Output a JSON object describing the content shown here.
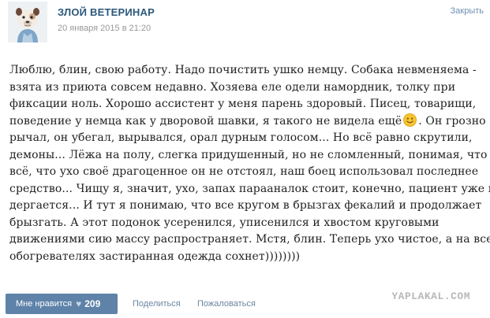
{
  "post": {
    "author": "ЗЛОЙ ВЕТЕРИНАР",
    "date": "20 января 2015 в 21:20",
    "close_label": "Закрыть",
    "lines": [
      "Люблю, блин, свою работу. Надо почистить ушко немцу. Собака невменяема -",
      "взята из приюта совсем недавно. Хозяева еле одели намордник, толку при",
      "фиксации ноль. Хорошо ассистент у меня парень здоровый. Писец, товарищи,",
      "поведение у немца как у дворовой шавки, я такого не видела ещё",
      ". Он грозно",
      "рычал, он убегал, вырывался, орал дурным голосом... Но всё равно скрутили,",
      "демоны... Лёжа на полу, слегка придушенный, но не сломленный, понимая, что",
      "всё, что ухо своё драгоценное он не отстоял, наш боец использовал последнее",
      "средство... Чищу я, значит, ухо, запах парааналок стоит, конечно, пациент уже не",
      "дергается... И тут я понимаю, что все кругом в брызгах фекалий и продолжает",
      "брызгать. А этот подонок усеренился, уписенился и хвостом круговыми",
      "движениями сию массу распространяет. Мстя, блин. Теперь ухо чистое, а на всех",
      "обогревателях застиранная одежда сохнет))))))))"
    ],
    "emoji_icon": "smile-icon"
  },
  "actions": {
    "like_label": "Мне нравится",
    "like_count": "209",
    "share_label": "Поделиться",
    "complain_label": "Пожаловаться"
  },
  "watermark": "YAPLAKAL.COM",
  "colors": {
    "author": "#2b587a",
    "like_button": "#5e82a8",
    "link": "#6b86a0",
    "date": "#999999"
  }
}
